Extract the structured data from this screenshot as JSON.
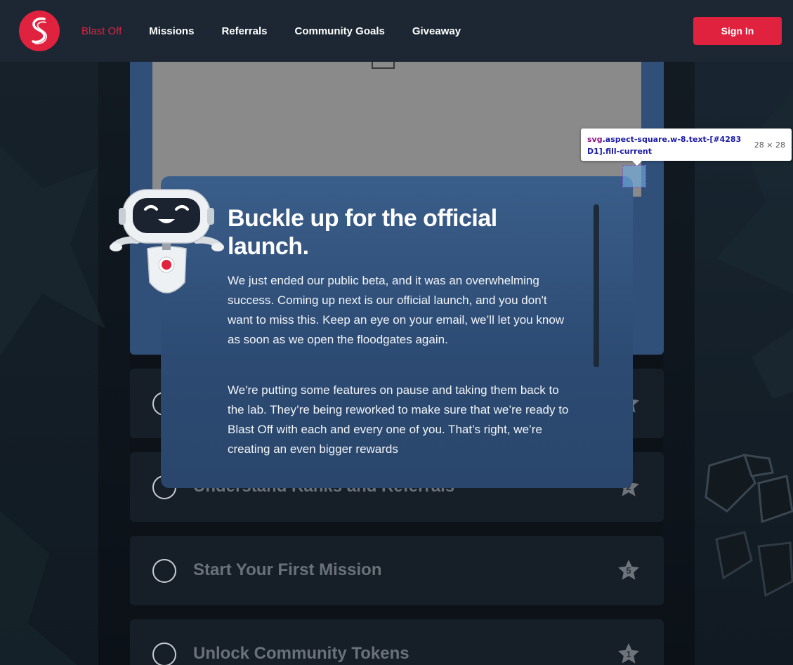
{
  "header": {
    "nav": [
      {
        "label": "Blast Off",
        "active": true
      },
      {
        "label": "Missions",
        "active": false
      },
      {
        "label": "Referrals",
        "active": false
      },
      {
        "label": "Community Goals",
        "active": false
      },
      {
        "label": "Giveaway",
        "active": false
      }
    ],
    "signin_label": "Sign In"
  },
  "modal": {
    "title": "Buckle up for the official launch.",
    "paragraphs": [
      "We just ended our public beta, and it was an overwhelming success. Coming up next is our official launch, and you don't want to miss this. Keep an eye on your email, we’ll let you know as soon as we open the floodgates again.",
      "We're putting some features on pause and taking them back to the lab. They’re being reworked to make sure that we’re ready to Blast Off with each and every one of you. That’s right, we’re creating an even bigger rewards"
    ]
  },
  "missions": [
    {
      "title": "",
      "points": ""
    },
    {
      "title": "Understand Ranks and Referrals",
      "points": "2"
    },
    {
      "title": "Start Your First Mission",
      "points": "5"
    },
    {
      "title": "Unlock Community Tokens",
      "points": "1"
    }
  ],
  "devtools": {
    "selector_tag": "svg",
    "selector_classes": ".aspect-square.w-8.text-[#4283D1].fill-current",
    "size": "28 × 28"
  },
  "colors": {
    "brand_red": "#e0223f",
    "header_bg": "#1c2733",
    "modal_bg": "#2f4f78",
    "card_bg": "#161f28"
  }
}
